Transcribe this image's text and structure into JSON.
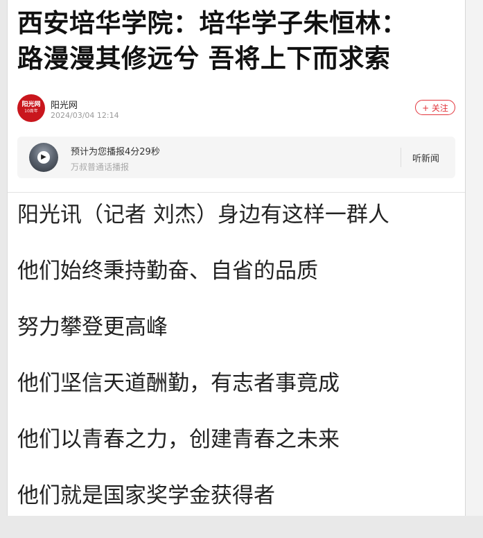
{
  "article": {
    "title_line1": "西安培华学院：培华学子朱恒林：",
    "title_line2": "路漫漫其修远兮 吾将上下而求索"
  },
  "source": {
    "logo_text": "阳光网",
    "logo_subtext": "10周年",
    "name": "阳光网",
    "time": "2024/03/04 12:14",
    "follow_label": "+ 关注"
  },
  "audio": {
    "line1": "预计为您播报4分29秒",
    "line2": "万叔普通话播报",
    "play_icon": "play-icon",
    "listen_label": "听新闻"
  },
  "body": {
    "paragraphs": [
      "阳光讯（记者 刘杰）身边有这样一群人",
      "他们始终秉持勤奋、自省的品质",
      "努力攀登更高峰",
      "他们坚信天道酬勤，有志者事竟成",
      "他们以青春之力，创建青春之未来",
      "他们就是国家奖学金获得者"
    ]
  },
  "colors": {
    "accent": "#e2333a",
    "logo": "#c9161d",
    "text": "#222222",
    "muted": "#999999"
  }
}
